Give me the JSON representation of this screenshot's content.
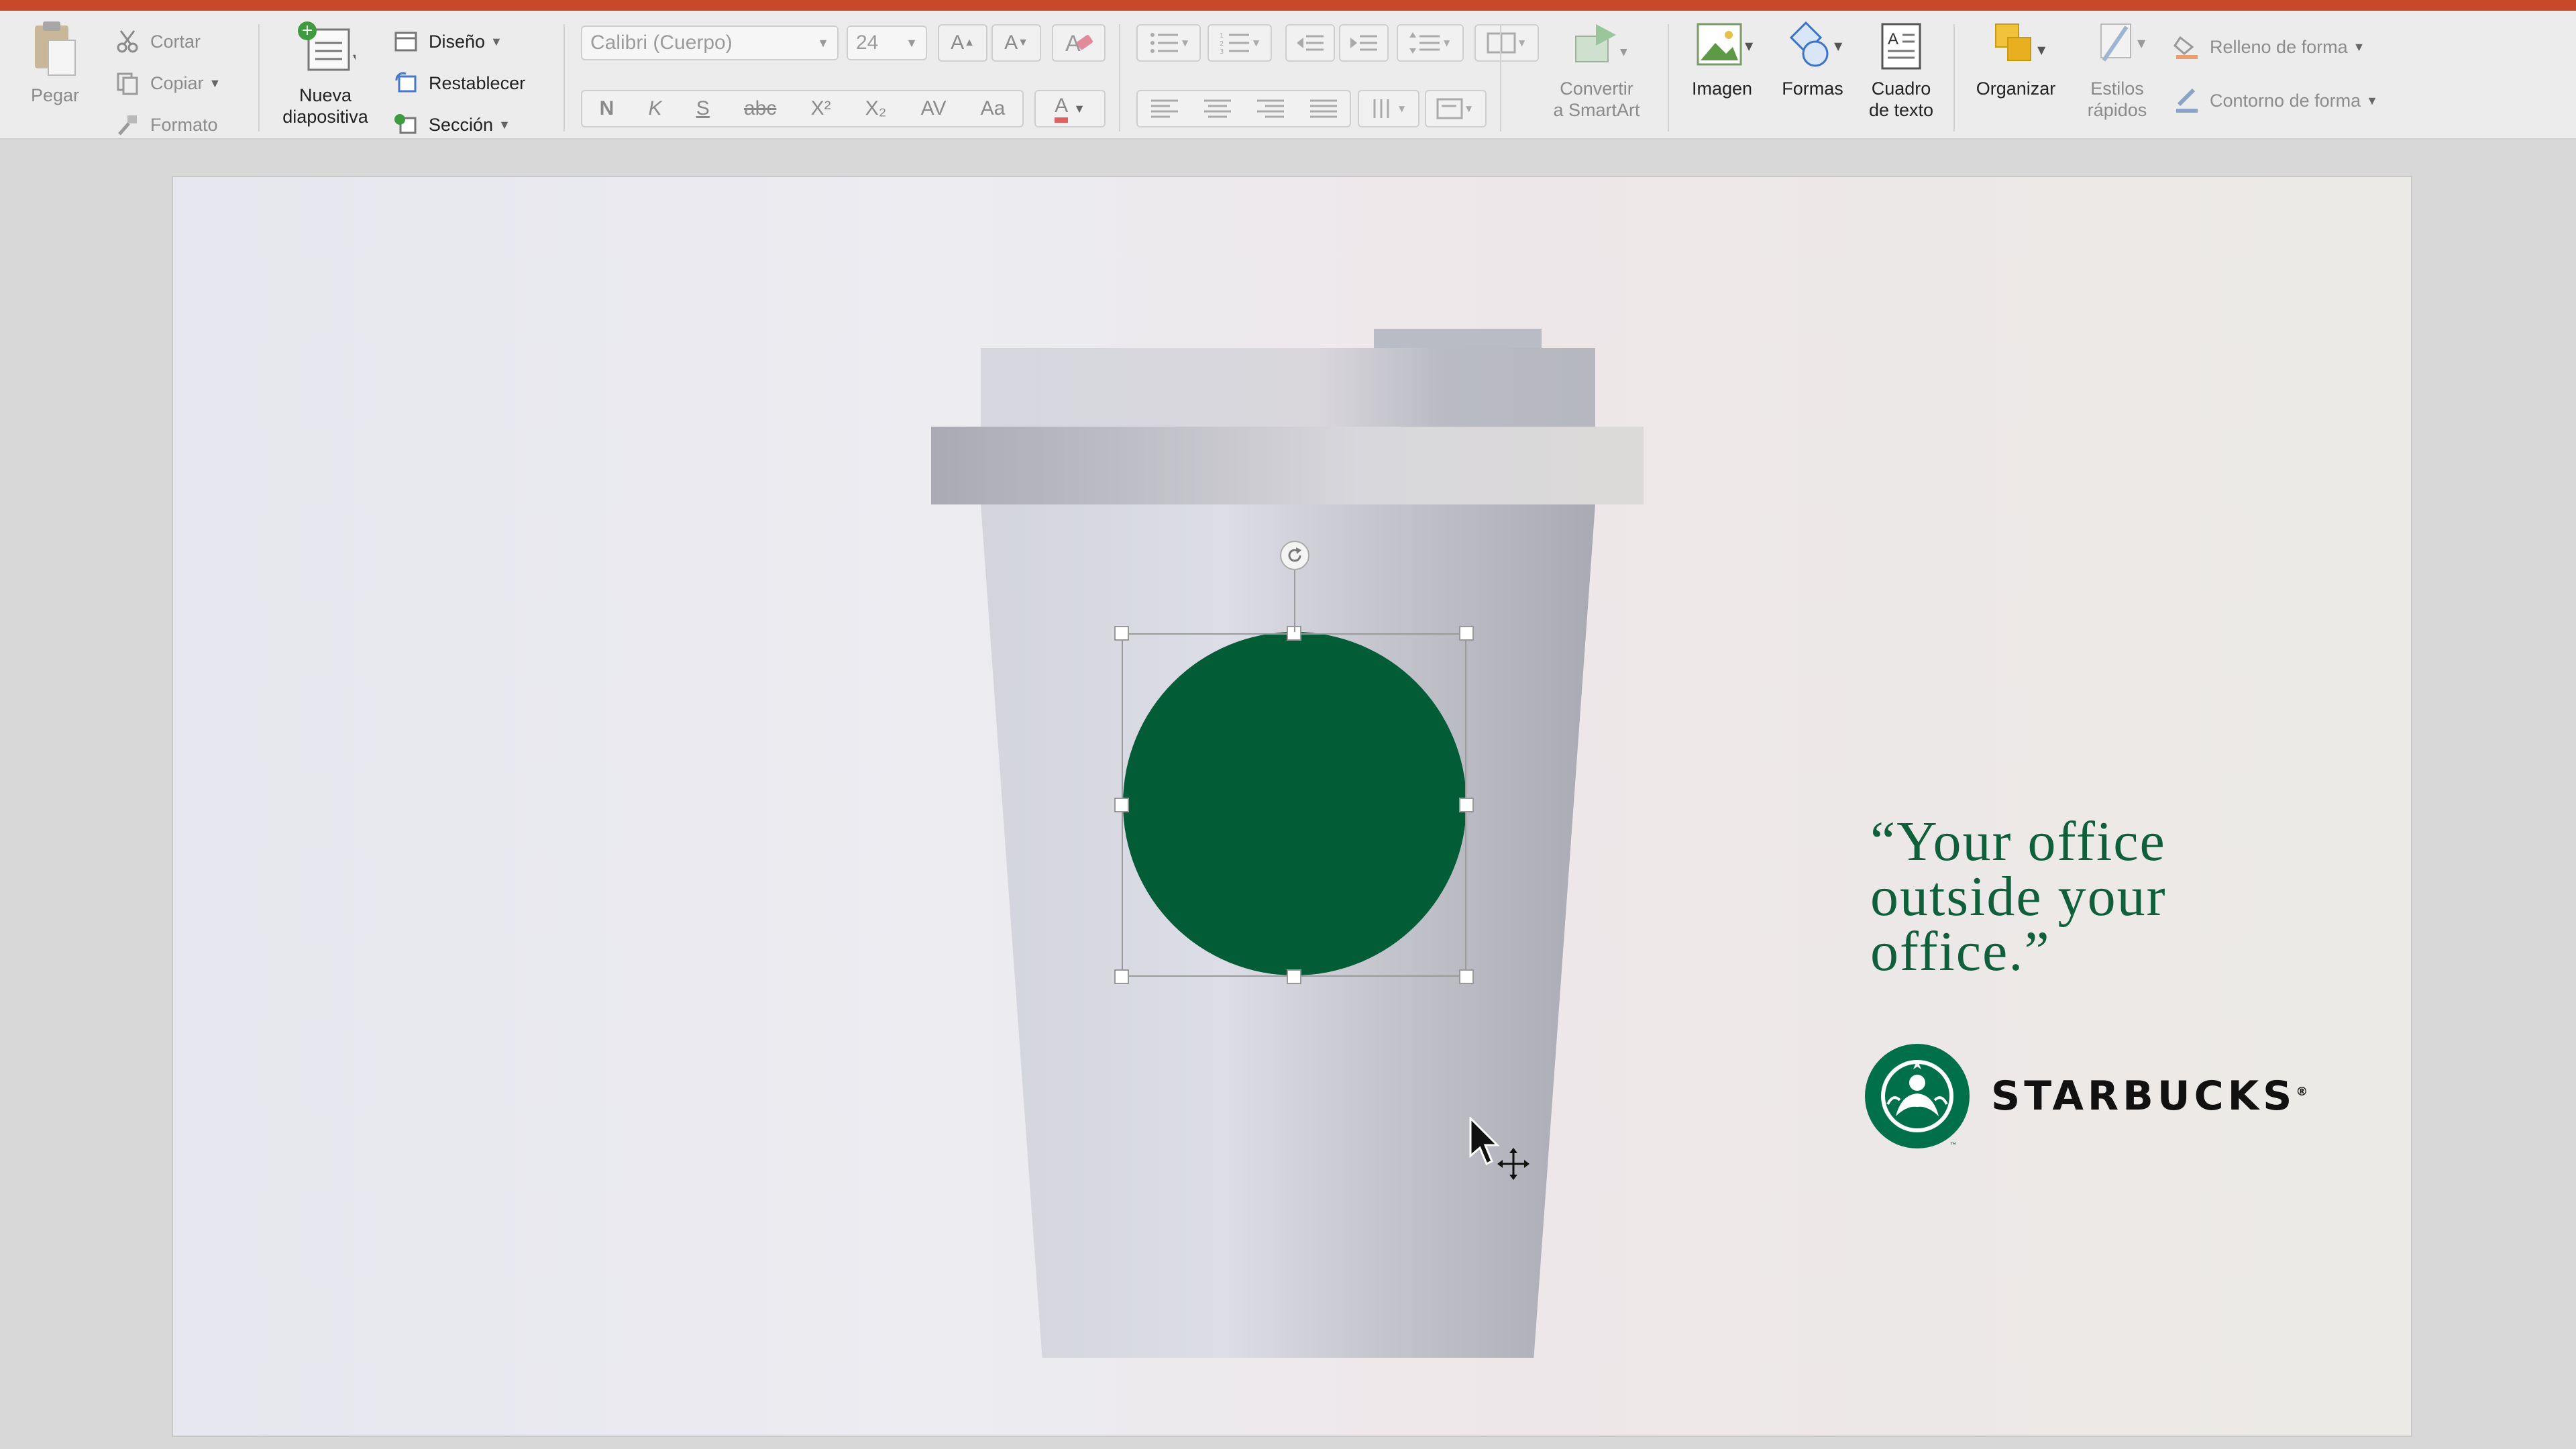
{
  "colors": {
    "title_bar": "#c8482a",
    "shape_fill": "#025c35",
    "quote_text": "#0e5f3a",
    "logo_green": "#00704a"
  },
  "ribbon": {
    "clipboard": {
      "paste": "Pegar",
      "cut": "Cortar",
      "copy": "Copiar",
      "format": "Formato"
    },
    "slides": {
      "new_slide_line1": "Nueva",
      "new_slide_line2": "diapositiva",
      "layout": "Diseño",
      "reset": "Restablecer",
      "section": "Sección"
    },
    "font": {
      "family": "Calibri (Cuerpo)",
      "size": "24",
      "grow": "A",
      "shrink": "A",
      "bold": "N",
      "italic": "K",
      "underline": "S",
      "strike": "abc",
      "superscript": "X²",
      "subscript": "X₂",
      "spacing": "AV",
      "case": "Aa",
      "color": "A"
    },
    "smartart": {
      "line1": "Convertir",
      "line2": "a SmartArt"
    },
    "insert": {
      "image": "Imagen",
      "shapes": "Formas",
      "textbox_line1": "Cuadro",
      "textbox_line2": "de texto"
    },
    "drawing": {
      "arrange": "Organizar",
      "quick_styles_line1": "Estilos",
      "quick_styles_line2": "rápidos",
      "shape_fill": "Relleno de forma",
      "shape_outline": "Contorno de forma"
    }
  },
  "slide": {
    "quote_line1": "“Your office",
    "quote_line2": "outside your",
    "quote_line3": "office.”",
    "brand": "STARBUCKS",
    "registered": "®",
    "tm": "™"
  }
}
